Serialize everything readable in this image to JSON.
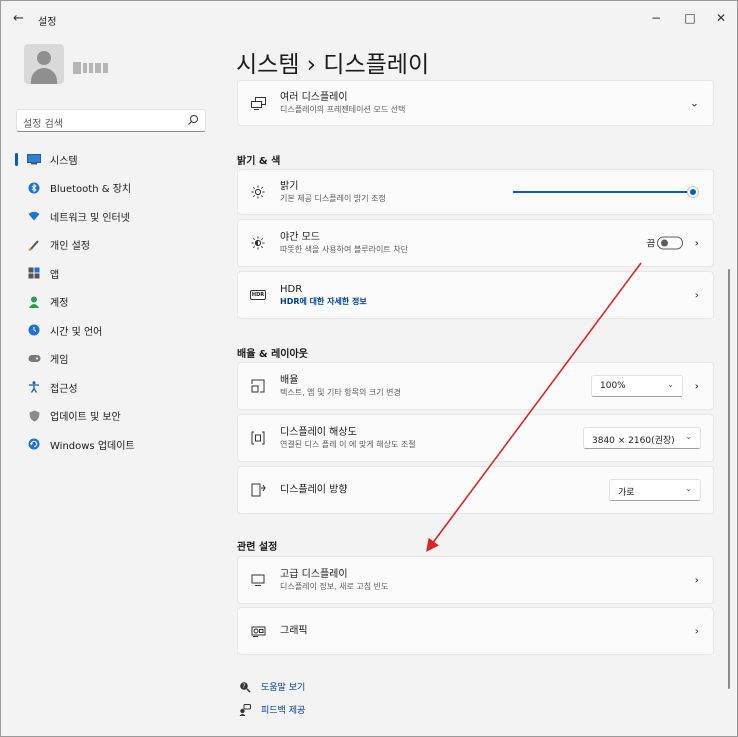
{
  "window": {
    "title": "설정",
    "controls": {
      "minimize": "−",
      "maximize": "□",
      "close": "✕"
    }
  },
  "search": {
    "placeholder": "설정 검색"
  },
  "sidebar": {
    "items": [
      {
        "label": "시스템",
        "icon": "system-icon",
        "active": true
      },
      {
        "label": "Bluetooth & 장치",
        "icon": "bluetooth-icon"
      },
      {
        "label": "네트워크 및 인터넷",
        "icon": "network-icon"
      },
      {
        "label": "개인 설정",
        "icon": "personalization-icon"
      },
      {
        "label": "앱",
        "icon": "apps-icon"
      },
      {
        "label": "계정",
        "icon": "accounts-icon"
      },
      {
        "label": "시간 및 언어",
        "icon": "time-language-icon"
      },
      {
        "label": "게임",
        "icon": "gaming-icon"
      },
      {
        "label": "접근성",
        "icon": "accessibility-icon"
      },
      {
        "label": "업데이트 및 보안",
        "icon": "security-icon"
      },
      {
        "label": "Windows 업데이트",
        "icon": "windows-update-icon"
      }
    ]
  },
  "main": {
    "breadcrumb": "시스템  ›  디스플레이",
    "multi_display": {
      "title": "여러 디스플레이",
      "subtitle": "디스플레이의 프레젠테이션 모드 선택"
    },
    "sections": {
      "brightness_color": "밝기 & 색",
      "scale_layout": "배율 & 레이아웃",
      "related": "관련 설정"
    },
    "brightness": {
      "title": "밝기",
      "subtitle": "기본 제공 디스플레이 밝기 조정",
      "level_percent": 100
    },
    "night_light": {
      "title": "야간 모드",
      "subtitle": "따뜻한 색을 사용하여 블루라이트 차단",
      "state_label": "끔",
      "on": false
    },
    "hdr": {
      "title": "HDR",
      "link": "HDR에 대한 자세한 정보",
      "icon_text": "HDR"
    },
    "scale": {
      "title": "배율",
      "subtitle": "텍스트, 앱 및 기타 항목의 크기 변경",
      "value": "100%"
    },
    "resolution": {
      "title": "디스플레이 해상도",
      "subtitle": "연결된 디스 플레 이 에 맞게 해상도 조절",
      "value": "3840 × 2160(권장)"
    },
    "orientation": {
      "title": "디스플레이 방향",
      "value": "가로"
    },
    "advanced_display": {
      "title": "고급 디스플레이",
      "subtitle": "디스플레이 정보, 새로 고침 빈도"
    },
    "graphics": {
      "title": "그래픽"
    }
  },
  "footer": {
    "help": "도움말 보기",
    "feedback": "피드백 제공"
  },
  "colors": {
    "accent": "#005fb8",
    "annotation_arrow": "#e02424"
  }
}
